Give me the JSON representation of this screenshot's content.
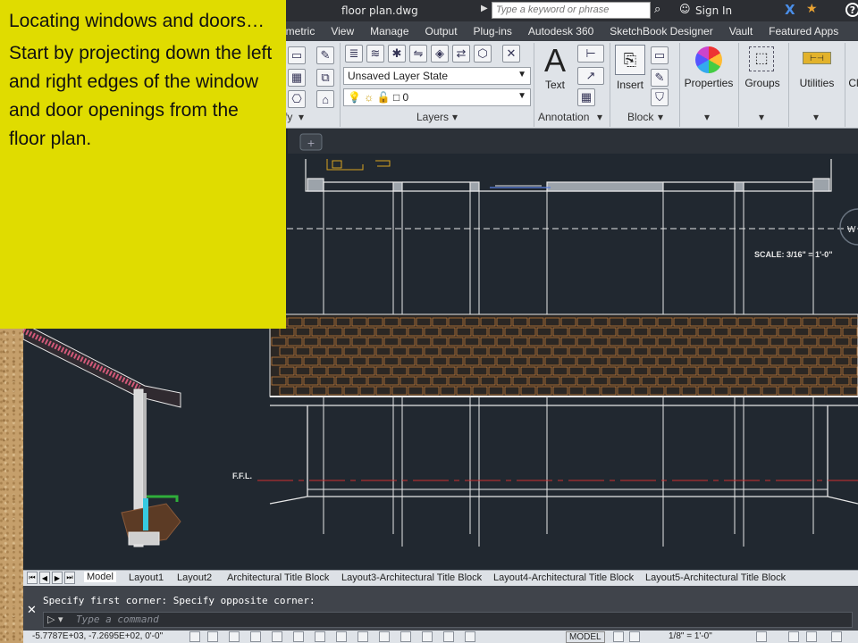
{
  "window": {
    "filename": "floor plan.dwg",
    "search_placeholder": "Type a keyword or phrase",
    "sign_in": "Sign In",
    "help": "?"
  },
  "ribbon_tabs": [
    "rametric",
    "View",
    "Manage",
    "Output",
    "Plug-ins",
    "Autodesk 360",
    "SketchBook Designer",
    "Vault",
    "Featured Apps"
  ],
  "ribbon": {
    "modify_title": "fy",
    "layers": {
      "title": "Layers",
      "layer_state": "Unsaved Layer State",
      "current_layer": "0"
    },
    "annotation": {
      "title": "Annotation",
      "text_label": "Text"
    },
    "block": {
      "title": "Block",
      "insert_label": "Insert"
    },
    "properties_label": "Properties",
    "groups_label": "Groups",
    "utilities_label": "Utilities",
    "clipboard_label": "Cl"
  },
  "drawing": {
    "scale_label": "SCALE: 3/16\" = 1'-0\"",
    "ffl_label": "F.F.L.",
    "colors": {
      "background": "#212830",
      "lines": "#e8e8e8",
      "brick": "#c07a3a",
      "red": "#d03030"
    }
  },
  "layout_tabs": [
    "Model",
    "Layout1",
    "Layout2",
    "Architectural Title Block",
    "Layout3-Architectural Title Block",
    "Layout4-Architectural Title Block",
    "Layout5-Architectural Title Block"
  ],
  "command": {
    "history": "Specify first corner: Specify opposite corner:",
    "placeholder": "Type a command",
    "prompt": "▷ ▾"
  },
  "status": {
    "coords": "-5.7787E+03, -7.2695E+02, 0'-0\"",
    "model": "MODEL",
    "scale": "1/8\" = 1'-0\""
  },
  "note": {
    "heading": "Locating windows and doors…",
    "body": "Start by projecting down the left and right edges of the window and door openings from the floor plan."
  }
}
